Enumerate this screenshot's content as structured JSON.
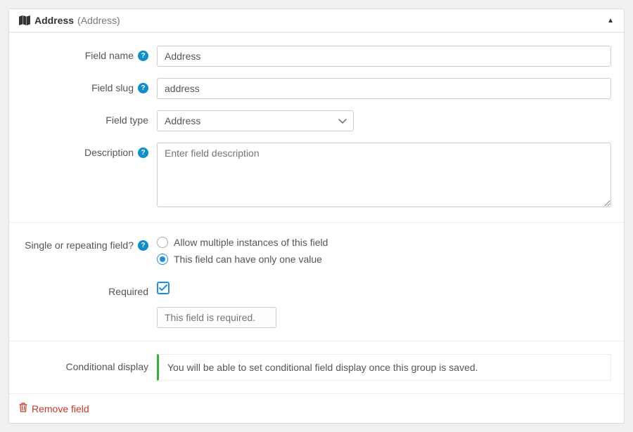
{
  "header": {
    "title": "Address",
    "subtitle": "(Address)"
  },
  "labels": {
    "field_name": "Field name",
    "field_slug": "Field slug",
    "field_type": "Field type",
    "description": "Description",
    "single_or_repeating": "Single or repeating field?",
    "required": "Required",
    "conditional_display": "Conditional display"
  },
  "values": {
    "field_name": "Address",
    "field_slug": "address",
    "field_type": "Address",
    "description": "",
    "description_placeholder": "Enter field description",
    "required_checked": true,
    "required_msg_placeholder": "This field is required."
  },
  "radios": {
    "allow_multiple": "Allow multiple instances of this field",
    "only_one": "This field can have only one value",
    "selected": "only_one"
  },
  "conditional_notice": "You will be able to set conditional field display once this group is saved.",
  "footer": {
    "remove": "Remove field"
  }
}
